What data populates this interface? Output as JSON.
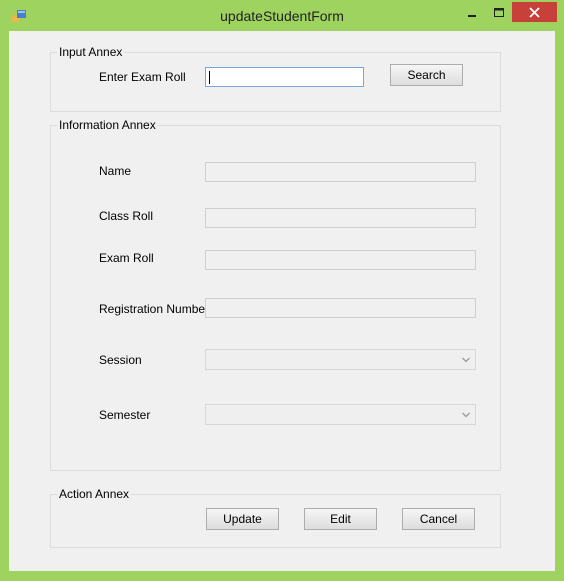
{
  "window": {
    "title": "updateStudentForm",
    "controls": {
      "minimize": "–",
      "maximize": "☐",
      "close": "✕"
    },
    "frame_color": "#9fd35f",
    "icon": "app-window-icon"
  },
  "input_annex": {
    "caption": "Input Annex",
    "exam_roll_label": "Enter Exam Roll",
    "exam_roll_value": "",
    "search_label": "Search"
  },
  "information_annex": {
    "caption": "Information Annex",
    "fields": [
      {
        "label": "Name",
        "value": ""
      },
      {
        "label": "Class Roll",
        "value": ""
      },
      {
        "label": "Exam Roll",
        "value": ""
      },
      {
        "label": "Registration Number",
        "value": ""
      },
      {
        "label": "Session",
        "value": ""
      },
      {
        "label": "Semester",
        "value": ""
      }
    ]
  },
  "action_annex": {
    "caption": "Action Annex",
    "update_label": "Update",
    "edit_label": "Edit",
    "cancel_label": "Cancel"
  }
}
